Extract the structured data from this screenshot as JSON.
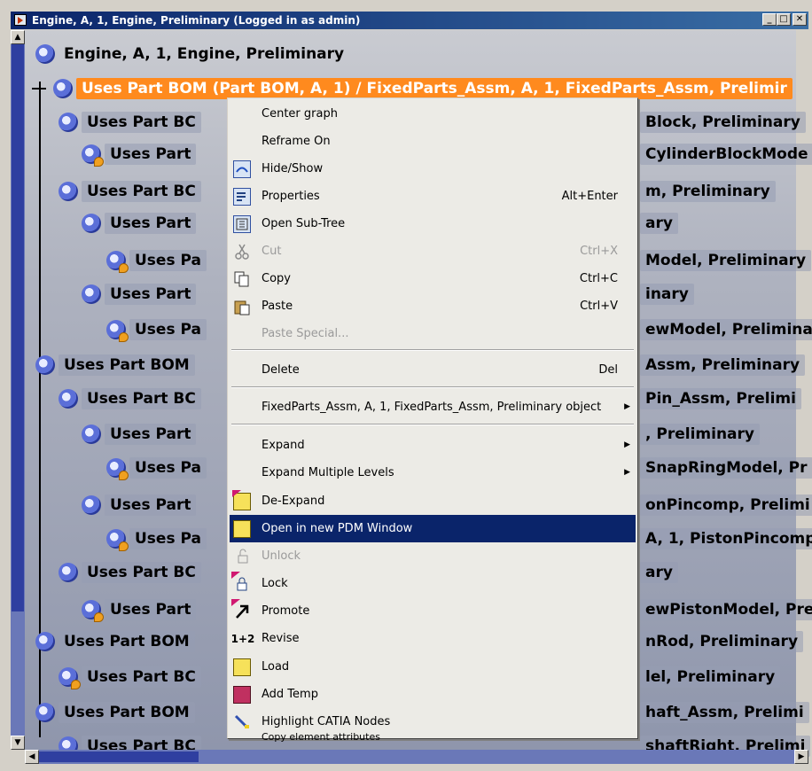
{
  "window": {
    "title": "Engine, A, 1, Engine, Preliminary (Logged in as admin)",
    "buttons": [
      "_",
      "□",
      "✕"
    ]
  },
  "tree": {
    "root_label": "Engine, A, 1, Engine, Preliminary",
    "selected_label": "Uses Part BOM (Part BOM, A, 1) / FixedParts_Assm, A, 1, FixedParts_Assm, Prelimir",
    "rows": [
      {
        "left": "Uses Part BC",
        "right": "Block, Preliminary"
      },
      {
        "left": "Uses Part",
        "right": "CylinderBlockMode"
      },
      {
        "left": "Uses Part BC",
        "right": "m, Preliminary"
      },
      {
        "left": "Uses Part",
        "right": "ary"
      },
      {
        "left": "Uses Pa",
        "right": "Model, Preliminary"
      },
      {
        "left": "Uses Part",
        "right": "inary"
      },
      {
        "left": "Uses Pa",
        "right": "ewModel, Prelimina"
      },
      {
        "left": "Uses Part BOM",
        "right": "Assm, Preliminary"
      },
      {
        "left": "Uses Part BC",
        "right": "Pin_Assm, Prelimi"
      },
      {
        "left": "Uses Part",
        "right": ", Preliminary"
      },
      {
        "left": "Uses Pa",
        "right": "SnapRingModel, Pr"
      },
      {
        "left": "Uses Part",
        "right": "onPincomp, Prelimi"
      },
      {
        "left": "Uses Pa",
        "right": "A, 1, PistonPincomp"
      },
      {
        "left": "Uses Part BC",
        "right": "ary"
      },
      {
        "left": "Uses Part",
        "right": "ewPistonModel, Pre"
      },
      {
        "left": "Uses Part BOM",
        "right": "nRod, Preliminary"
      },
      {
        "left": "Uses Part BC",
        "right": "lel, Preliminary"
      },
      {
        "left": "Uses Part BOM",
        "right": "haft_Assm, Prelimi"
      },
      {
        "left": "Uses Part BC",
        "right": "shaftRight, Prelimi"
      }
    ]
  },
  "context_menu": {
    "items": [
      {
        "label": "Center graph",
        "shortcut": "",
        "icon": "",
        "disabled": false
      },
      {
        "label": "Reframe On",
        "shortcut": "",
        "icon": "",
        "disabled": false
      },
      {
        "label": "Hide/Show",
        "shortcut": "",
        "icon": "hide-show-icon",
        "disabled": false
      },
      {
        "label": "Properties",
        "shortcut": "Alt+Enter",
        "icon": "properties-icon",
        "disabled": false
      },
      {
        "label": "Open Sub-Tree",
        "shortcut": "",
        "icon": "subtree-icon",
        "disabled": false
      },
      {
        "label": "Cut",
        "shortcut": "Ctrl+X",
        "icon": "scissors-icon",
        "disabled": true
      },
      {
        "label": "Copy",
        "shortcut": "Ctrl+C",
        "icon": "copy-icon",
        "disabled": false
      },
      {
        "label": "Paste",
        "shortcut": "Ctrl+V",
        "icon": "paste-icon",
        "disabled": false
      },
      {
        "label": "Paste Special...",
        "shortcut": "",
        "icon": "",
        "disabled": true
      },
      {
        "label": "Delete",
        "shortcut": "Del",
        "icon": "",
        "disabled": false
      },
      {
        "label": "FixedParts_Assm, A, 1, FixedParts_Assm, Preliminary object",
        "shortcut": "",
        "icon": "",
        "disabled": false,
        "submenu": true
      },
      {
        "label": "Expand",
        "shortcut": "",
        "icon": "",
        "disabled": false,
        "submenu": true
      },
      {
        "label": "Expand Multiple Levels",
        "shortcut": "",
        "icon": "",
        "disabled": false,
        "submenu": true
      },
      {
        "label": "De-Expand",
        "shortcut": "",
        "icon": "de-expand-icon",
        "disabled": false
      },
      {
        "label": "Open in new PDM Window",
        "shortcut": "",
        "icon": "new-window-icon",
        "disabled": false,
        "highlighted": true
      },
      {
        "label": "Unlock",
        "shortcut": "",
        "icon": "unlock-icon",
        "disabled": true
      },
      {
        "label": "Lock",
        "shortcut": "",
        "icon": "lock-icon",
        "disabled": false
      },
      {
        "label": "Promote",
        "shortcut": "",
        "icon": "promote-arrow-icon",
        "disabled": false
      },
      {
        "label": "Revise",
        "shortcut": "",
        "icon": "revise-icon",
        "disabled": false
      },
      {
        "label": "Load",
        "shortcut": "",
        "icon": "load-icon",
        "disabled": false
      },
      {
        "label": "Add Temp",
        "shortcut": "",
        "icon": "add-temp-icon",
        "disabled": false
      },
      {
        "label": "Highlight CATIA Nodes",
        "shortcut": "",
        "icon": "highlight-icon",
        "disabled": false
      },
      {
        "label": "Copy element attributes",
        "shortcut": "",
        "icon": "copy-attributes-icon",
        "disabled": false
      }
    ],
    "revise_icon_text": "1+2"
  },
  "colors": {
    "selected": "#ff8a1e",
    "menu_highlight": "#0a246a",
    "titlebar": "#0a246a"
  }
}
